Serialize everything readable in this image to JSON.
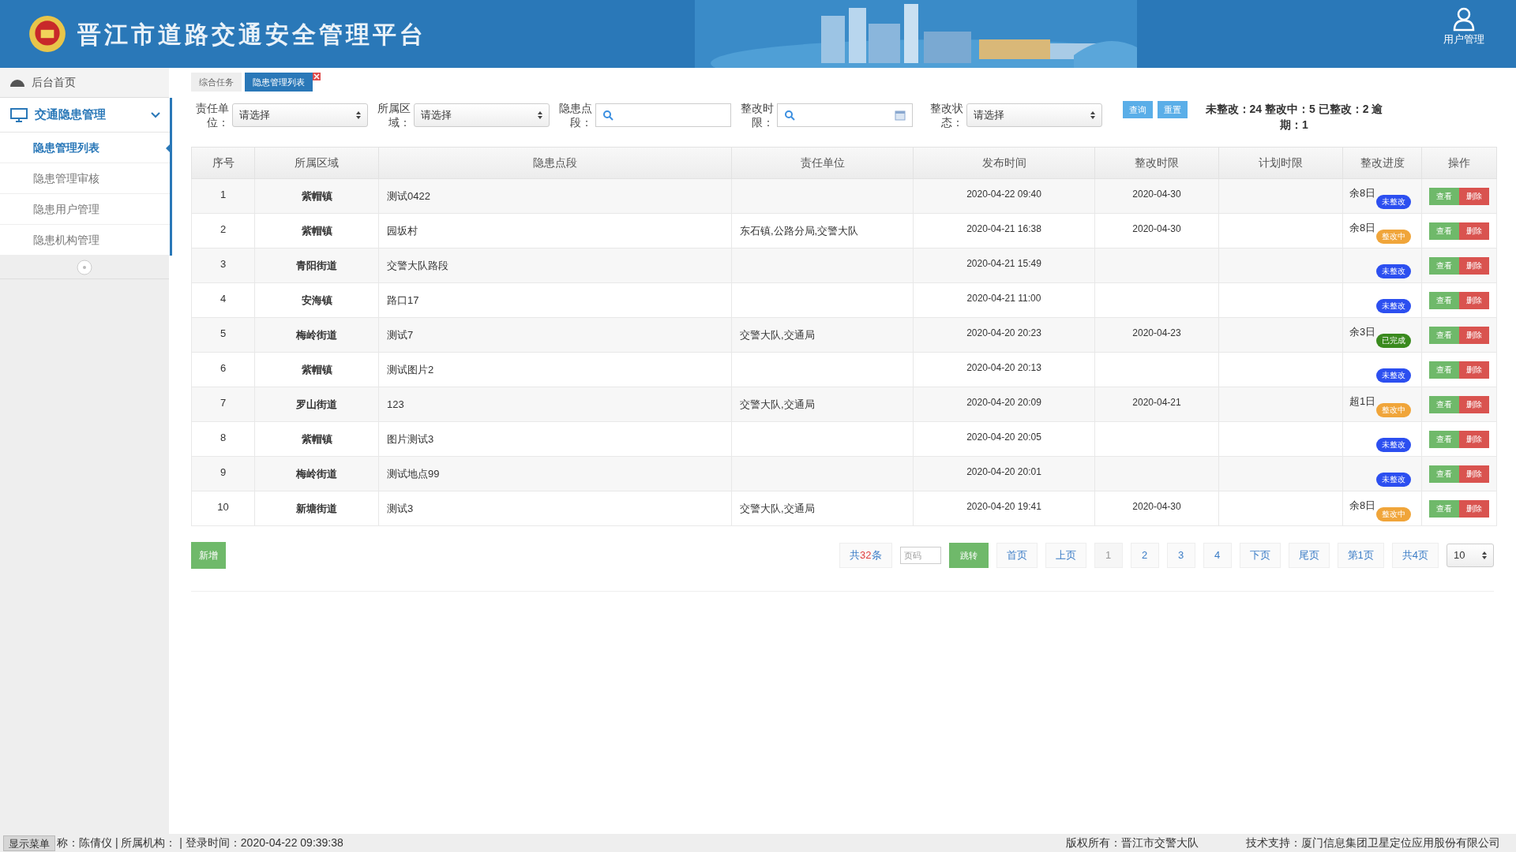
{
  "header": {
    "title": "晋江市道路交通安全管理平台",
    "user_link": "用户管理"
  },
  "sidebar": {
    "home": "后台首页",
    "groups": [
      {
        "label": "交通隐患管理",
        "expanded": true,
        "children": [
          {
            "label": "隐患管理列表",
            "selected": true
          },
          {
            "label": "隐患管理审核",
            "selected": false
          },
          {
            "label": "隐患用户管理",
            "selected": false
          },
          {
            "label": "隐患机构管理",
            "selected": false
          }
        ]
      }
    ]
  },
  "tabs": [
    {
      "label": "综合任务",
      "selected": false,
      "closable": false
    },
    {
      "label": "隐患管理列表",
      "selected": true,
      "closable": true
    }
  ],
  "filters": [
    {
      "label": "责任单位：",
      "kind": "select",
      "value": "请选择"
    },
    {
      "label": "所属区域：",
      "kind": "select",
      "value": "请选择"
    },
    {
      "label": "隐患点段：",
      "kind": "search"
    },
    {
      "label": "整改时限：",
      "kind": "date"
    },
    {
      "label": "整改状态：",
      "kind": "select",
      "value": "请选择"
    }
  ],
  "actions": [
    "查询",
    "重置"
  ],
  "summary": "未整改：24 整改中：5 已整改：2 逾期：1",
  "table": {
    "columns": [
      "序号",
      "所属区域",
      "隐患点段",
      "责任单位",
      "发布时间",
      "整改时限",
      "计划时限",
      "整改进度",
      "操作"
    ],
    "rows": [
      {
        "no": "1",
        "region": "紫帽镇",
        "spot": "测试0422",
        "unit": "",
        "published": "2020-04-22 09:40",
        "deadline": "2020-04-30",
        "planned": "",
        "remaining": "余8日",
        "status": "未整改",
        "kind": "pending",
        "actions": [
          "查看",
          "删除"
        ]
      },
      {
        "no": "2",
        "region": "紫帽镇",
        "spot": "园坂村",
        "unit": "东石镇,公路分局,交警大队",
        "published": "2020-04-21 16:38",
        "deadline": "2020-04-30",
        "planned": "",
        "remaining": "余8日",
        "status": "整改中",
        "kind": "progress",
        "actions": [
          "查看",
          "删除"
        ]
      },
      {
        "no": "3",
        "region": "青阳街道",
        "spot": "交警大队路段",
        "unit": "",
        "published": "2020-04-21 15:49",
        "deadline": "",
        "planned": "",
        "remaining": "",
        "status": "未整改",
        "kind": "pending",
        "actions": [
          "查看",
          "删除"
        ]
      },
      {
        "no": "4",
        "region": "安海镇",
        "spot": "路口17",
        "unit": "",
        "published": "2020-04-21 11:00",
        "deadline": "",
        "planned": "",
        "remaining": "",
        "status": "未整改",
        "kind": "pending",
        "actions": [
          "查看",
          "删除"
        ]
      },
      {
        "no": "5",
        "region": "梅岭街道",
        "spot": "测试7",
        "unit": "交警大队,交通局",
        "published": "2020-04-20 20:23",
        "deadline": "2020-04-23",
        "planned": "",
        "remaining": "余3日",
        "status": "已完成",
        "kind": "done",
        "actions": [
          "查看",
          "删除"
        ]
      },
      {
        "no": "6",
        "region": "紫帽镇",
        "spot": "测试图片2",
        "unit": "",
        "published": "2020-04-20 20:13",
        "deadline": "",
        "planned": "",
        "remaining": "",
        "status": "未整改",
        "kind": "pending",
        "actions": [
          "查看",
          "删除"
        ]
      },
      {
        "no": "7",
        "region": "罗山街道",
        "spot": "123",
        "unit": "交警大队,交通局",
        "published": "2020-04-20 20:09",
        "deadline": "2020-04-21",
        "planned": "",
        "remaining": "超1日",
        "status": "整改中",
        "kind": "progress",
        "actions": [
          "查看",
          "删除"
        ]
      },
      {
        "no": "8",
        "region": "紫帽镇",
        "spot": "图片测试3",
        "unit": "",
        "published": "2020-04-20 20:05",
        "deadline": "",
        "planned": "",
        "remaining": "",
        "status": "未整改",
        "kind": "pending",
        "actions": [
          "查看",
          "删除"
        ]
      },
      {
        "no": "9",
        "region": "梅岭街道",
        "spot": "测试地点99",
        "unit": "",
        "published": "2020-04-20 20:01",
        "deadline": "",
        "planned": "",
        "remaining": "",
        "status": "未整改",
        "kind": "pending",
        "actions": [
          "查看",
          "删除"
        ]
      },
      {
        "no": "10",
        "region": "新塘街道",
        "spot": "测试3",
        "unit": "交警大队,交通局",
        "published": "2020-04-20 19:41",
        "deadline": "2020-04-30",
        "planned": "",
        "remaining": "余8日",
        "status": "整改中",
        "kind": "progress",
        "actions": [
          "查看",
          "删除"
        ]
      }
    ]
  },
  "add_button": "新增",
  "pagination": {
    "total_prefix": "共",
    "total_count": "32",
    "total_suffix": "条",
    "page_input_placeholder": "页码",
    "jump": "跳转",
    "nav": [
      {
        "label": "首页",
        "selected": false
      },
      {
        "label": "上页",
        "selected": false
      },
      {
        "label": "1",
        "selected": true
      },
      {
        "label": "2",
        "selected": false
      },
      {
        "label": "3",
        "selected": false
      },
      {
        "label": "4",
        "selected": false
      },
      {
        "label": "下页",
        "selected": false
      },
      {
        "label": "尾页",
        "selected": false
      }
    ],
    "current": "第1页",
    "pages": "共4页",
    "page_size": "10"
  },
  "status_bar": {
    "menu_button": "显示菜单",
    "user_info": "称：陈倩仪 | 所属机构： | 登录时间：2020-04-22 09:39:38",
    "copyright": "版权所有：晋江市交警大队",
    "support": "技术支持：厦门信息集团卫星定位应用股份有限公司"
  }
}
